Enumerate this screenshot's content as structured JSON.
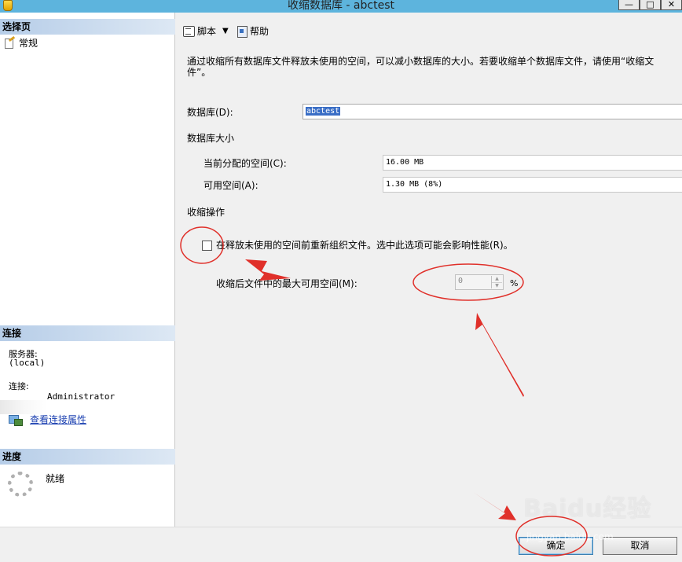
{
  "window": {
    "title": "收缩数据库 - abctest",
    "minimize_glyph": "—",
    "maximize_glyph": "□",
    "close_glyph": "✕"
  },
  "left_pane": {
    "select_page_header": "选择页",
    "pages": [
      {
        "label": "常规",
        "icon": "properties-icon"
      }
    ],
    "connection_header": "连接",
    "server_label": "服务器:",
    "server_value": "(local)",
    "connection_label": "连接:",
    "connection_value": "Administrator",
    "view_connection_properties": "查看连接属性",
    "progress_header": "进度",
    "progress_status": "就绪"
  },
  "toolbar": {
    "script_label": "脚本",
    "dropdown_glyph": "▼",
    "help_label": "帮助"
  },
  "form": {
    "description": "通过收缩所有数据库文件释放未使用的空间，可以减小数据库的大小。若要收缩单个数据库文件，请使用“收缩文件”。",
    "database_label": "数据库(D):",
    "database_value": "abctest",
    "db_size_header": "数据库大小",
    "allocated_label": "当前分配的空间(C):",
    "allocated_value": "16.00 MB",
    "available_label": "可用空间(A):",
    "available_value": "1.30 MB (8%)",
    "shrink_action_header": "收缩操作",
    "reorganize_label": "在释放未使用的空间前重新组织文件。选中此选项可能会影响性能(R)。",
    "reorganize_checked": false,
    "max_free_label": "收缩后文件中的最大可用空间(M):",
    "max_free_value": "0",
    "max_free_unit": "%"
  },
  "footer": {
    "ok_label": "确定",
    "cancel_label": "取消"
  },
  "watermark": {
    "brand": "Baidu经验",
    "url": "jingyan.baidu.com"
  },
  "annotation_color": "#e0302a"
}
